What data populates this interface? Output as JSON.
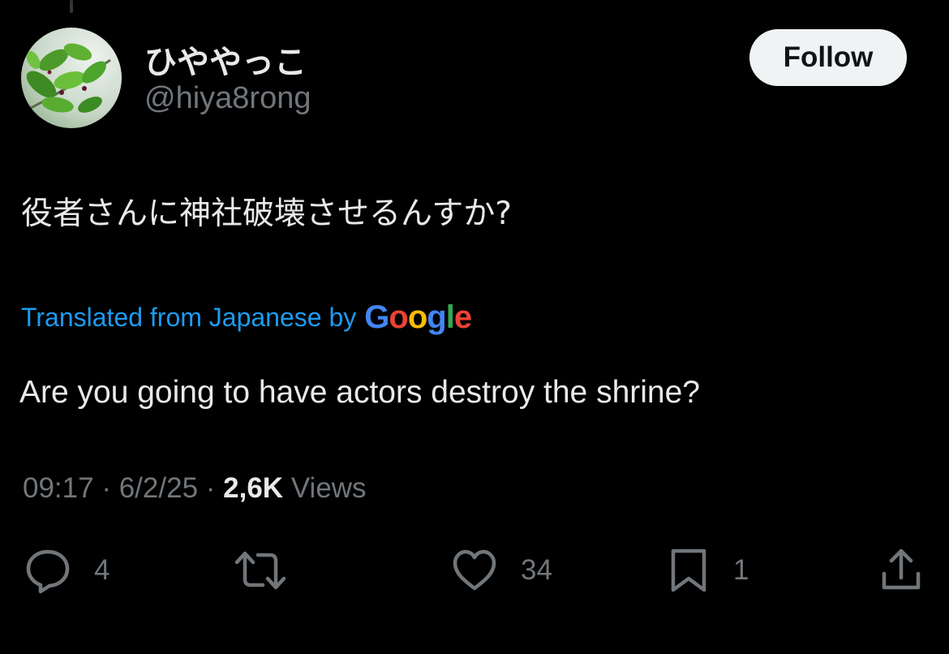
{
  "user": {
    "display_name": "ひややっこ",
    "handle": "@hiya8rong",
    "follow_label": "Follow",
    "avatar_icon": "leaf-photo-avatar"
  },
  "tweet": {
    "text": "役者さんに神社破壊させるんすか?",
    "translation": {
      "label": "Translated from Japanese by",
      "provider": "Google",
      "provider_letters": [
        "G",
        "o",
        "o",
        "g",
        "l",
        "e"
      ],
      "provider_colors": [
        "#4285f4",
        "#ea4335",
        "#fbbc05",
        "#4285f4",
        "#34a853",
        "#ea4335"
      ],
      "text": "Are you going to have actors destroy the shrine?"
    },
    "time": "09:17",
    "date": "6/2/25",
    "separator": "·",
    "views_count": "2,6K",
    "views_label": "Views"
  },
  "actions": {
    "reply": {
      "icon": "reply-icon",
      "count": "4"
    },
    "retweet": {
      "icon": "retweet-icon",
      "count": ""
    },
    "like": {
      "icon": "heart-icon",
      "count": "34"
    },
    "bookmark": {
      "icon": "bookmark-icon",
      "count": "1"
    },
    "share": {
      "icon": "share-icon",
      "count": ""
    }
  },
  "colors": {
    "background": "#000000",
    "text_primary": "#e7e9ea",
    "text_secondary": "#71767b",
    "link": "#1d9bf0",
    "follow_bg": "#eff3f4"
  }
}
